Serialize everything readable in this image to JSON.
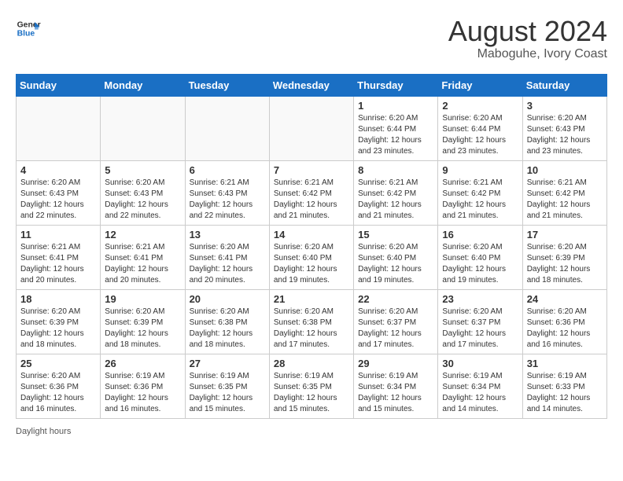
{
  "header": {
    "logo_line1": "General",
    "logo_line2": "Blue",
    "month_title": "August 2024",
    "location": "Maboguhe, Ivory Coast"
  },
  "days_of_week": [
    "Sunday",
    "Monday",
    "Tuesday",
    "Wednesday",
    "Thursday",
    "Friday",
    "Saturday"
  ],
  "weeks": [
    [
      {
        "day": "",
        "info": ""
      },
      {
        "day": "",
        "info": ""
      },
      {
        "day": "",
        "info": ""
      },
      {
        "day": "",
        "info": ""
      },
      {
        "day": "1",
        "info": "Sunrise: 6:20 AM\nSunset: 6:44 PM\nDaylight: 12 hours\nand 23 minutes."
      },
      {
        "day": "2",
        "info": "Sunrise: 6:20 AM\nSunset: 6:44 PM\nDaylight: 12 hours\nand 23 minutes."
      },
      {
        "day": "3",
        "info": "Sunrise: 6:20 AM\nSunset: 6:43 PM\nDaylight: 12 hours\nand 23 minutes."
      }
    ],
    [
      {
        "day": "4",
        "info": "Sunrise: 6:20 AM\nSunset: 6:43 PM\nDaylight: 12 hours\nand 22 minutes."
      },
      {
        "day": "5",
        "info": "Sunrise: 6:20 AM\nSunset: 6:43 PM\nDaylight: 12 hours\nand 22 minutes."
      },
      {
        "day": "6",
        "info": "Sunrise: 6:21 AM\nSunset: 6:43 PM\nDaylight: 12 hours\nand 22 minutes."
      },
      {
        "day": "7",
        "info": "Sunrise: 6:21 AM\nSunset: 6:42 PM\nDaylight: 12 hours\nand 21 minutes."
      },
      {
        "day": "8",
        "info": "Sunrise: 6:21 AM\nSunset: 6:42 PM\nDaylight: 12 hours\nand 21 minutes."
      },
      {
        "day": "9",
        "info": "Sunrise: 6:21 AM\nSunset: 6:42 PM\nDaylight: 12 hours\nand 21 minutes."
      },
      {
        "day": "10",
        "info": "Sunrise: 6:21 AM\nSunset: 6:42 PM\nDaylight: 12 hours\nand 21 minutes."
      }
    ],
    [
      {
        "day": "11",
        "info": "Sunrise: 6:21 AM\nSunset: 6:41 PM\nDaylight: 12 hours\nand 20 minutes."
      },
      {
        "day": "12",
        "info": "Sunrise: 6:21 AM\nSunset: 6:41 PM\nDaylight: 12 hours\nand 20 minutes."
      },
      {
        "day": "13",
        "info": "Sunrise: 6:20 AM\nSunset: 6:41 PM\nDaylight: 12 hours\nand 20 minutes."
      },
      {
        "day": "14",
        "info": "Sunrise: 6:20 AM\nSunset: 6:40 PM\nDaylight: 12 hours\nand 19 minutes."
      },
      {
        "day": "15",
        "info": "Sunrise: 6:20 AM\nSunset: 6:40 PM\nDaylight: 12 hours\nand 19 minutes."
      },
      {
        "day": "16",
        "info": "Sunrise: 6:20 AM\nSunset: 6:40 PM\nDaylight: 12 hours\nand 19 minutes."
      },
      {
        "day": "17",
        "info": "Sunrise: 6:20 AM\nSunset: 6:39 PM\nDaylight: 12 hours\nand 18 minutes."
      }
    ],
    [
      {
        "day": "18",
        "info": "Sunrise: 6:20 AM\nSunset: 6:39 PM\nDaylight: 12 hours\nand 18 minutes."
      },
      {
        "day": "19",
        "info": "Sunrise: 6:20 AM\nSunset: 6:39 PM\nDaylight: 12 hours\nand 18 minutes."
      },
      {
        "day": "20",
        "info": "Sunrise: 6:20 AM\nSunset: 6:38 PM\nDaylight: 12 hours\nand 18 minutes."
      },
      {
        "day": "21",
        "info": "Sunrise: 6:20 AM\nSunset: 6:38 PM\nDaylight: 12 hours\nand 17 minutes."
      },
      {
        "day": "22",
        "info": "Sunrise: 6:20 AM\nSunset: 6:37 PM\nDaylight: 12 hours\nand 17 minutes."
      },
      {
        "day": "23",
        "info": "Sunrise: 6:20 AM\nSunset: 6:37 PM\nDaylight: 12 hours\nand 17 minutes."
      },
      {
        "day": "24",
        "info": "Sunrise: 6:20 AM\nSunset: 6:36 PM\nDaylight: 12 hours\nand 16 minutes."
      }
    ],
    [
      {
        "day": "25",
        "info": "Sunrise: 6:20 AM\nSunset: 6:36 PM\nDaylight: 12 hours\nand 16 minutes."
      },
      {
        "day": "26",
        "info": "Sunrise: 6:19 AM\nSunset: 6:36 PM\nDaylight: 12 hours\nand 16 minutes."
      },
      {
        "day": "27",
        "info": "Sunrise: 6:19 AM\nSunset: 6:35 PM\nDaylight: 12 hours\nand 15 minutes."
      },
      {
        "day": "28",
        "info": "Sunrise: 6:19 AM\nSunset: 6:35 PM\nDaylight: 12 hours\nand 15 minutes."
      },
      {
        "day": "29",
        "info": "Sunrise: 6:19 AM\nSunset: 6:34 PM\nDaylight: 12 hours\nand 15 minutes."
      },
      {
        "day": "30",
        "info": "Sunrise: 6:19 AM\nSunset: 6:34 PM\nDaylight: 12 hours\nand 14 minutes."
      },
      {
        "day": "31",
        "info": "Sunrise: 6:19 AM\nSunset: 6:33 PM\nDaylight: 12 hours\nand 14 minutes."
      }
    ]
  ],
  "footer": {
    "daylight_label": "Daylight hours"
  }
}
